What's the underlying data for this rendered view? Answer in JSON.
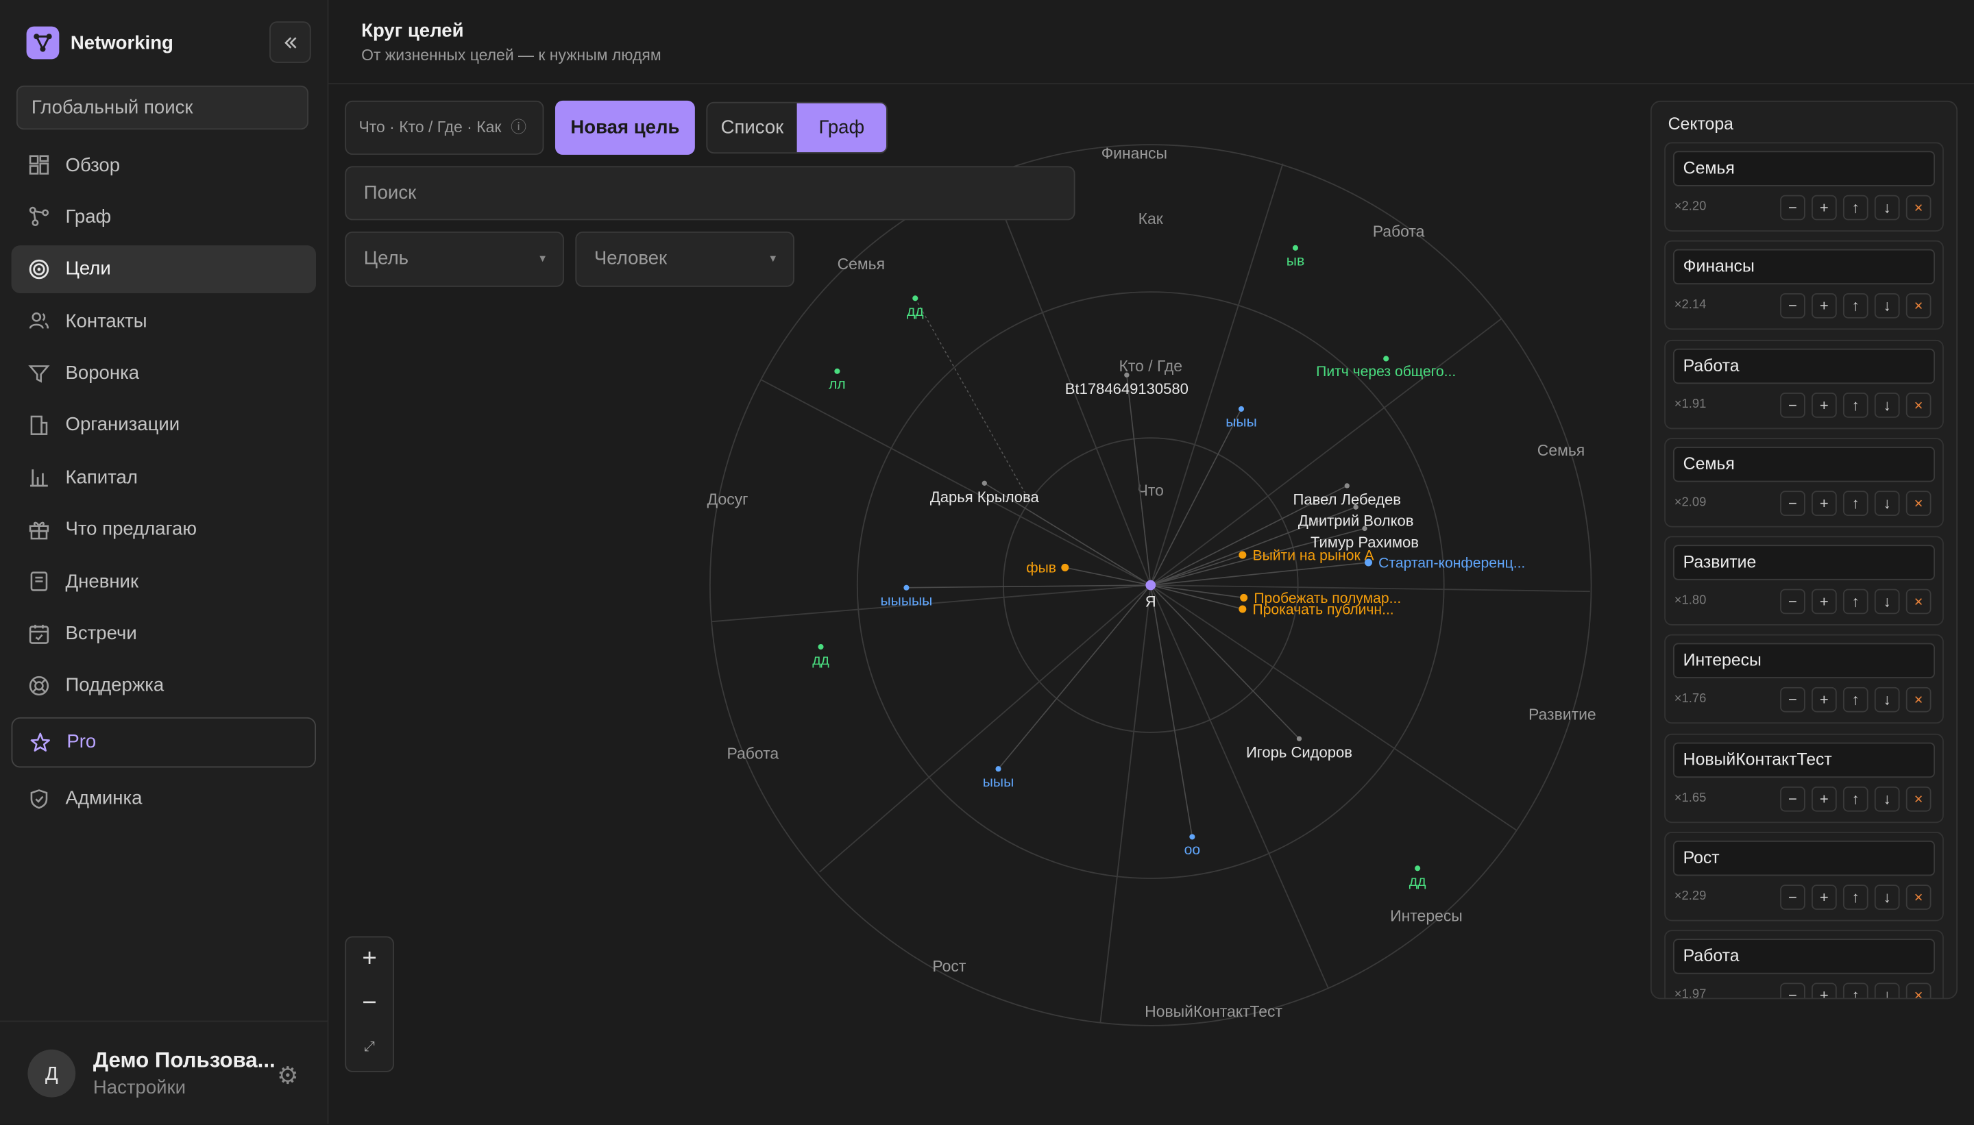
{
  "sidebar": {
    "brand": "Networking",
    "collapse_icon": "chevrons-left-icon",
    "search_placeholder": "Глобальный поиск",
    "items": [
      {
        "label": "Обзор",
        "icon": "dashboard-icon"
      },
      {
        "label": "Граф",
        "icon": "graph-icon"
      },
      {
        "label": "Цели",
        "icon": "target-icon",
        "active": true
      },
      {
        "label": "Контакты",
        "icon": "users-icon"
      },
      {
        "label": "Воронка",
        "icon": "funnel-icon"
      },
      {
        "label": "Организации",
        "icon": "building-icon"
      },
      {
        "label": "Капитал",
        "icon": "bar-chart-icon"
      },
      {
        "label": "Что предлагаю",
        "icon": "gift-icon"
      },
      {
        "label": "Дневник",
        "icon": "notebook-icon"
      },
      {
        "label": "Встречи",
        "icon": "calendar-check-icon"
      },
      {
        "label": "Поддержка",
        "icon": "lifebuoy-icon"
      },
      {
        "label": "Pro",
        "icon": "star-icon"
      },
      {
        "label": "Админка",
        "icon": "shield-check-icon"
      }
    ],
    "user": {
      "initial": "Д",
      "name": "Демо Пользова...",
      "settings": "Настройки"
    }
  },
  "header": {
    "title": "Круг целей",
    "subtitle": "От жизненных целей — к нужным людям"
  },
  "toolbar": {
    "hint": "Что · Кто / Где · Как",
    "new_goal": "Новая цель",
    "view_list": "Список",
    "view_graph": "Граф",
    "search_placeholder": "Поиск",
    "filter_goal": "Цель",
    "filter_person": "Человек"
  },
  "graph": {
    "ring_labels": [
      "Что",
      "Кто / Где",
      "Как"
    ],
    "sector_labels": [
      "Финансы",
      "Работа",
      "Семья",
      "Развитие",
      "Интересы",
      "НовыйКонтактТест",
      "Рост",
      "Работа",
      "Досуг",
      "Семья"
    ],
    "center": "Я",
    "people": [
      "Bt1784649130580",
      "Дарья Крылова",
      "Павел Лебедев",
      "Дмитрий Волков",
      "Тимур Рахимов",
      "Игорь Сидоров"
    ],
    "goals": [
      {
        "label": "ыв",
        "color": "#4ade80"
      },
      {
        "label": "дд",
        "color": "#4ade80"
      },
      {
        "label": "лл",
        "color": "#4ade80"
      },
      {
        "label": "Питч через общего...",
        "color": "#4ade80"
      },
      {
        "label": "ыыы",
        "color": "#60a5fa"
      },
      {
        "label": "ыыыыы",
        "color": "#60a5fa"
      },
      {
        "label": "дд",
        "color": "#4ade80"
      },
      {
        "label": "ыыы",
        "color": "#60a5fa"
      },
      {
        "label": "оо",
        "color": "#60a5fa"
      },
      {
        "label": "дд",
        "color": "#4ade80"
      },
      {
        "label": "фыв",
        "color": "#f59e0b"
      },
      {
        "label": "Выйти на рынок А",
        "color": "#f59e0b"
      },
      {
        "label": "Стартап-конференц...",
        "color": "#60a5fa"
      },
      {
        "label": "Пробежать полумар...",
        "color": "#f59e0b"
      },
      {
        "label": "Прокачать публичн...",
        "color": "#f59e0b"
      }
    ]
  },
  "zoom": {
    "in": "+",
    "out": "−",
    "fit": "⤢"
  },
  "sectors": {
    "title": "Сектора",
    "items": [
      {
        "name": "Семья",
        "weight": "×2.20"
      },
      {
        "name": "Финансы",
        "weight": "×2.14"
      },
      {
        "name": "Работа",
        "weight": "×1.91"
      },
      {
        "name": "Семья",
        "weight": "×2.09"
      },
      {
        "name": "Развитие",
        "weight": "×1.80"
      },
      {
        "name": "Интересы",
        "weight": "×1.76"
      },
      {
        "name": "НовыйКонтактТест",
        "weight": "×1.65"
      },
      {
        "name": "Рост",
        "weight": "×2.29"
      },
      {
        "name": "Работа",
        "weight": "×1.97"
      }
    ],
    "buttons": [
      "−",
      "+",
      "↑",
      "↓",
      "×"
    ]
  },
  "colors": {
    "accent": "#a78bfa",
    "goal_green": "#4ade80",
    "goal_blue": "#60a5fa",
    "goal_orange": "#f59e0b"
  }
}
